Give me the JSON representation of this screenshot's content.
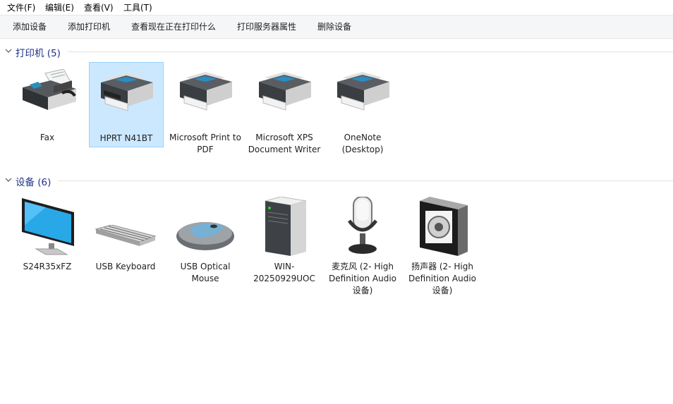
{
  "menu": [
    {
      "label": "文件(F)"
    },
    {
      "label": "编辑(E)"
    },
    {
      "label": "查看(V)"
    },
    {
      "label": "工具(T)"
    }
  ],
  "toolbar": [
    {
      "label": "添加设备"
    },
    {
      "label": "添加打印机"
    },
    {
      "label": "查看现在正在打印什么"
    },
    {
      "label": "打印服务器属性"
    },
    {
      "label": "删除设备"
    }
  ],
  "printers_group": {
    "title": "打印机 (5)",
    "items": [
      {
        "label": "Fax",
        "icon": "fax-icon"
      },
      {
        "label": "HPRT N41BT",
        "icon": "printer-icon",
        "selected": true
      },
      {
        "label": "Microsoft Print to PDF",
        "icon": "printer-icon"
      },
      {
        "label": "Microsoft XPS Document Writer",
        "icon": "printer-icon"
      },
      {
        "label": "OneNote (Desktop)",
        "icon": "printer-icon"
      }
    ]
  },
  "devices_group": {
    "title": "设备 (6)",
    "items": [
      {
        "label": "S24R35xFZ",
        "icon": "monitor-icon"
      },
      {
        "label": "USB Keyboard",
        "icon": "keyboard-icon"
      },
      {
        "label": "USB Optical Mouse",
        "icon": "mouse-icon"
      },
      {
        "label": "WIN-20250929UOC",
        "icon": "computer-tower-icon"
      },
      {
        "label": "麦克风 (2- High Definition Audio 设备)",
        "icon": "microphone-icon"
      },
      {
        "label": "扬声器 (2- High Definition Audio 设备)",
        "icon": "speaker-icon"
      }
    ]
  },
  "colors": {
    "group_title": "#1e3287",
    "selection_bg": "#cce8ff",
    "selection_border": "#99d1ff",
    "toolbar_bg": "#f5f6f7"
  }
}
